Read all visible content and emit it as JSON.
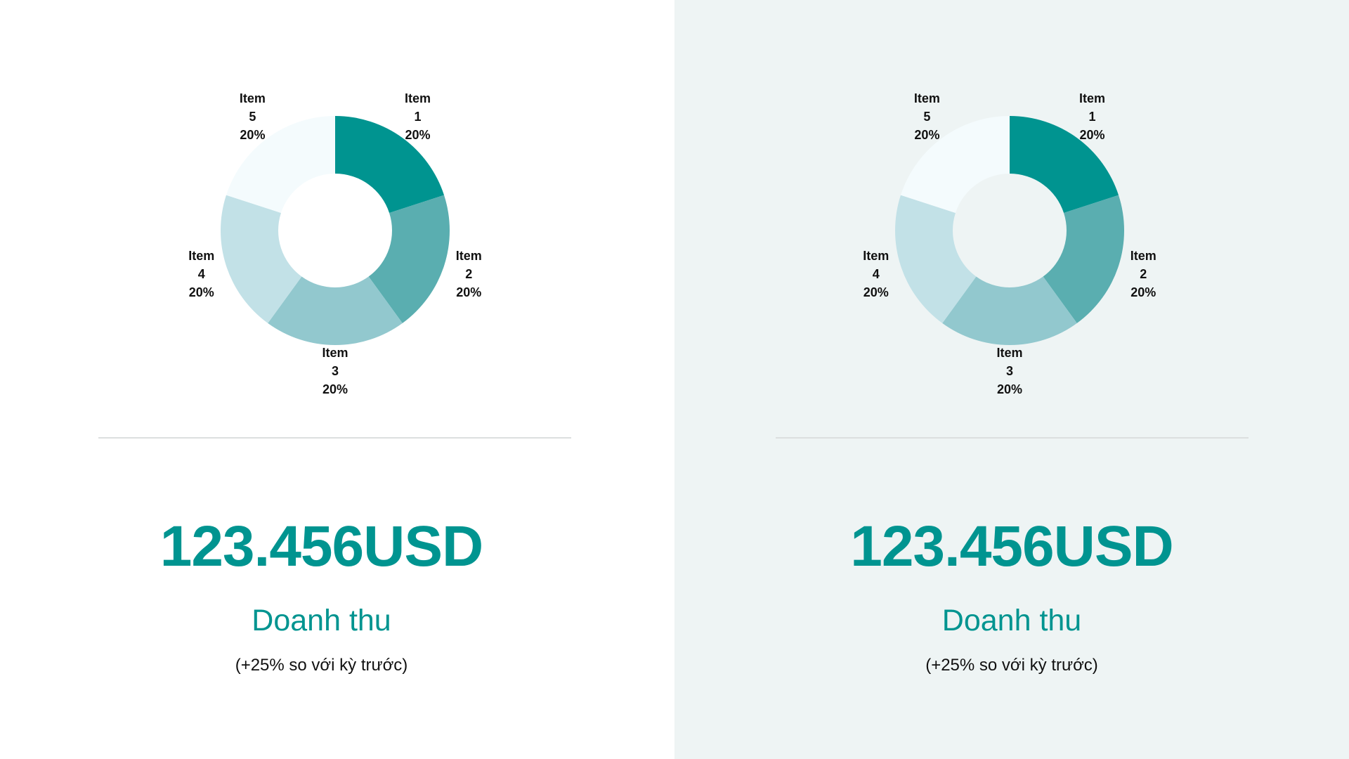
{
  "chart_data": [
    {
      "type": "pie",
      "variant": "donut",
      "categories": [
        "Item 1",
        "Item 2",
        "Item 3",
        "Item 4",
        "Item 5"
      ],
      "values": [
        20,
        20,
        20,
        20,
        20
      ],
      "labels": [
        {
          "line1": "Item",
          "line2": "1",
          "line3": "20%"
        },
        {
          "line1": "Item",
          "line2": "2",
          "line3": "20%"
        },
        {
          "line1": "Item",
          "line2": "3",
          "line3": "20%"
        },
        {
          "line1": "Item",
          "line2": "4",
          "line3": "20%"
        },
        {
          "line1": "Item",
          "line2": "5",
          "line3": "20%"
        }
      ],
      "colors": [
        "#009490",
        "#5aaeb0",
        "#92c8ce",
        "#c2e1e7",
        "#f4fbfd"
      ]
    },
    {
      "type": "pie",
      "variant": "donut",
      "categories": [
        "Item 1",
        "Item 2",
        "Item 3",
        "Item 4",
        "Item 5"
      ],
      "values": [
        20,
        20,
        20,
        20,
        20
      ],
      "labels": [
        {
          "line1": "Item",
          "line2": "1",
          "line3": "20%"
        },
        {
          "line1": "Item",
          "line2": "2",
          "line3": "20%"
        },
        {
          "line1": "Item",
          "line2": "3",
          "line3": "20%"
        },
        {
          "line1": "Item",
          "line2": "4",
          "line3": "20%"
        },
        {
          "line1": "Item",
          "line2": "5",
          "line3": "20%"
        }
      ],
      "colors": [
        "#009490",
        "#5aaeb0",
        "#92c8ce",
        "#c2e1e7",
        "#f4fbfd"
      ]
    }
  ],
  "panels": [
    {
      "kpi_value": "123.456USD",
      "kpi_label": "Doanh thu",
      "kpi_change": "(+25% so với kỳ trước)",
      "background": "#ffffff"
    },
    {
      "kpi_value": "123.456USD",
      "kpi_label": "Doanh thu",
      "kpi_change": "(+25% so với kỳ trước)",
      "background": "#eef4f4"
    }
  ],
  "colors": {
    "accent": "#009490",
    "text": "#111111",
    "divider": "#dcdfdf"
  }
}
